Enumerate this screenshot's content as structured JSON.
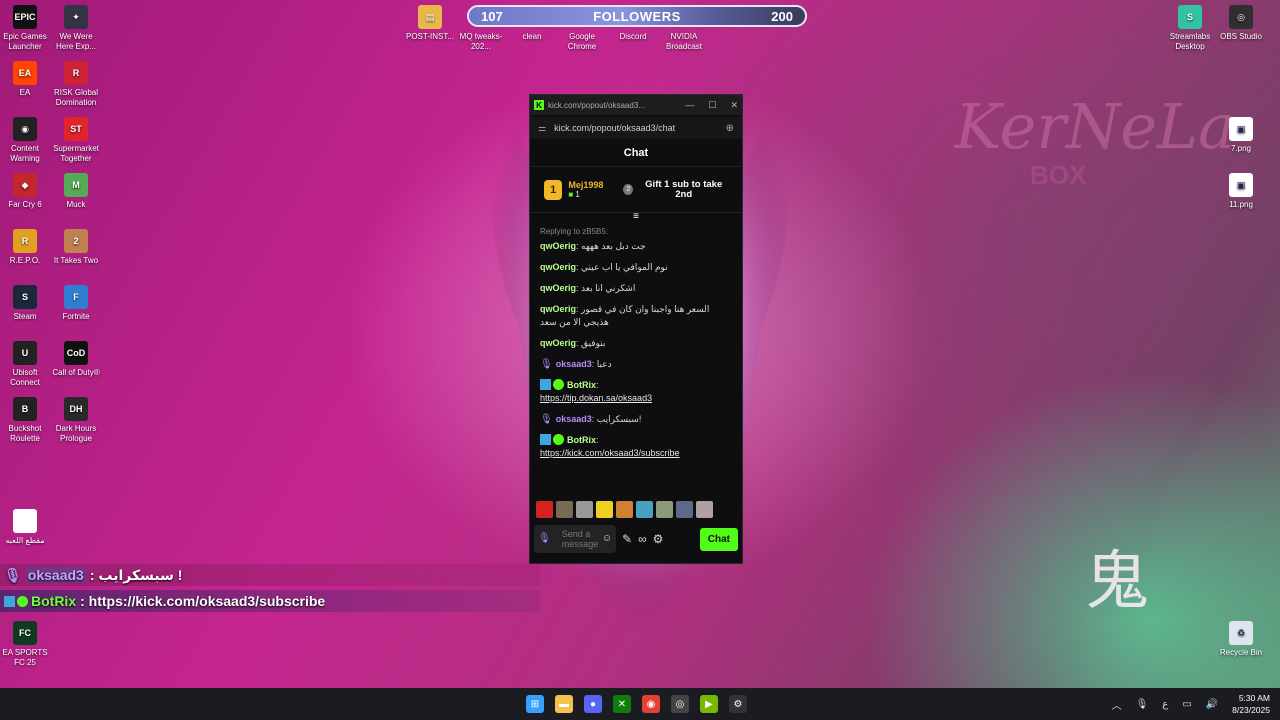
{
  "desktop": {
    "left_icons": [
      {
        "label": "Epic Games Launcher",
        "glyph": "EPIC",
        "color": "#111111"
      },
      {
        "label": "We Were Here Exp...",
        "glyph": "✦",
        "color": "#333344"
      },
      {
        "label": "EA",
        "glyph": "EA",
        "color": "#ff4500"
      },
      {
        "label": "RISK Global Domination",
        "glyph": "R",
        "color": "#cc2233"
      },
      {
        "label": "Content Warning",
        "glyph": "◉",
        "color": "#222222"
      },
      {
        "label": "Supermarket Together",
        "glyph": "ST",
        "color": "#e0242a"
      },
      {
        "label": "Far Cry 6",
        "glyph": "◆",
        "color": "#c1272d"
      },
      {
        "label": "Muck",
        "glyph": "M",
        "color": "#55aa55"
      },
      {
        "label": "R.E.P.O.",
        "glyph": "R",
        "color": "#e0a020"
      },
      {
        "label": "It Takes Two",
        "glyph": "2",
        "color": "#c08050"
      },
      {
        "label": "Steam",
        "glyph": "S",
        "color": "#1b2838"
      },
      {
        "label": "Fortnite",
        "glyph": "F",
        "color": "#2f7fd0"
      },
      {
        "label": "Ubisoft Connect",
        "glyph": "U",
        "color": "#222222"
      },
      {
        "label": "Call of Duty®",
        "glyph": "CoD",
        "color": "#111111"
      },
      {
        "label": "Buckshot Roulette",
        "glyph": "B",
        "color": "#222222"
      },
      {
        "label": "Dark Hours Prologue",
        "glyph": "DH",
        "color": "#2a2a2a"
      },
      {
        "label": "مقطع اللعبه",
        "glyph": "",
        "color": "#ffffff"
      },
      {
        "label": "EA SPORTS FC 25",
        "glyph": "FC",
        "color": "#0d3b22"
      }
    ],
    "top_icons": [
      {
        "label": "POST-INST...",
        "glyph": "▤",
        "color": "#e8b84a"
      },
      {
        "label": "MQ tweaks-202...",
        "glyph": "",
        "color": "transparent"
      },
      {
        "label": "clean",
        "glyph": "",
        "color": "transparent"
      },
      {
        "label": "Google Chrome",
        "glyph": "",
        "color": "transparent"
      },
      {
        "label": "Discord",
        "glyph": "",
        "color": "transparent"
      },
      {
        "label": "NVIDIA Broadcast",
        "glyph": "",
        "color": "transparent"
      }
    ],
    "right_icons": [
      {
        "label": "Streamlabs Desktop",
        "glyph": "S",
        "color": "#31c3a2"
      },
      {
        "label": "OBS Studio",
        "glyph": "◎",
        "color": "#302e31"
      },
      {
        "label": "7.png",
        "glyph": "▣",
        "color": "#ffffff"
      },
      {
        "label": "11.png",
        "glyph": "▣",
        "color": "#ffffff"
      },
      {
        "label": "Recycle Bin",
        "glyph": "♻",
        "color": "#dde6ee"
      }
    ],
    "watermark": "KerNeLa",
    "watermark_sub": "BOX",
    "kanji": "鬼"
  },
  "followers_bar": {
    "current": "107",
    "title": "FOLLOWERS",
    "goal": "200",
    "progress": 0.535
  },
  "kick_window": {
    "title": "kick.com/popout/oksaad3...",
    "url": "kick.com/popout/oksaad3/chat",
    "chat_header": "Chat",
    "top_gifter": {
      "rank": "1",
      "name": "Mej1998",
      "count": "1",
      "next_rank": "2",
      "gift_text": "Gift 1 sub to take 2nd"
    },
    "messages": [
      {
        "type": "reply_header",
        "text": "Replying to zB5B5:"
      },
      {
        "user": "qwOerig",
        "text": "جت دبل بعد هههه"
      },
      {
        "user": "qwOerig",
        "text": "نوم الموافي يا اب عيني"
      },
      {
        "user": "qwOerig",
        "text": "اشكرني انا بعد"
      },
      {
        "user": "qwOerig",
        "text": "السعر هنا واجبنا وان كان في قصور هذيجي الا من سعد"
      },
      {
        "user": "qwOerig",
        "text": "بتوفيق"
      },
      {
        "user": "oksaad3",
        "text": "دعبا"
      },
      {
        "user": "BotRix",
        "text": "https://tip.dokan.sa/oksaad3"
      },
      {
        "user": "oksaad3",
        "text": "سبسكرايب!"
      },
      {
        "user": "BotRix",
        "text": "https://kick.com/oksaad3/subscribe"
      }
    ],
    "input_placeholder": "Send a message",
    "chat_button": "Chat"
  },
  "overlay": {
    "row1": {
      "user": "oksaad3",
      "text": ": سبسكرايب !"
    },
    "row2": {
      "user": "BotRix",
      "text": ": https://kick.com/oksaad3/subscribe"
    }
  },
  "taskbar": {
    "icons": [
      {
        "name": "start-icon",
        "glyph": "⊞",
        "color": "#3aa0ff"
      },
      {
        "name": "file-explorer-icon",
        "glyph": "▬",
        "color": "#f2c14e"
      },
      {
        "name": "discord-icon",
        "glyph": "●",
        "color": "#5865f2"
      },
      {
        "name": "xbox-icon",
        "glyph": "✕",
        "color": "#107c10"
      },
      {
        "name": "chrome-icon",
        "glyph": "◉",
        "color": "#e34133"
      },
      {
        "name": "obs-icon",
        "glyph": "◎",
        "color": "#444444"
      },
      {
        "name": "nvidia-icon",
        "glyph": "▶",
        "color": "#76b900"
      },
      {
        "name": "settings-icon",
        "glyph": "⚙",
        "color": "#333333"
      }
    ],
    "lang": "ع",
    "time": "5:30 AM",
    "date": "8/23/2025"
  }
}
